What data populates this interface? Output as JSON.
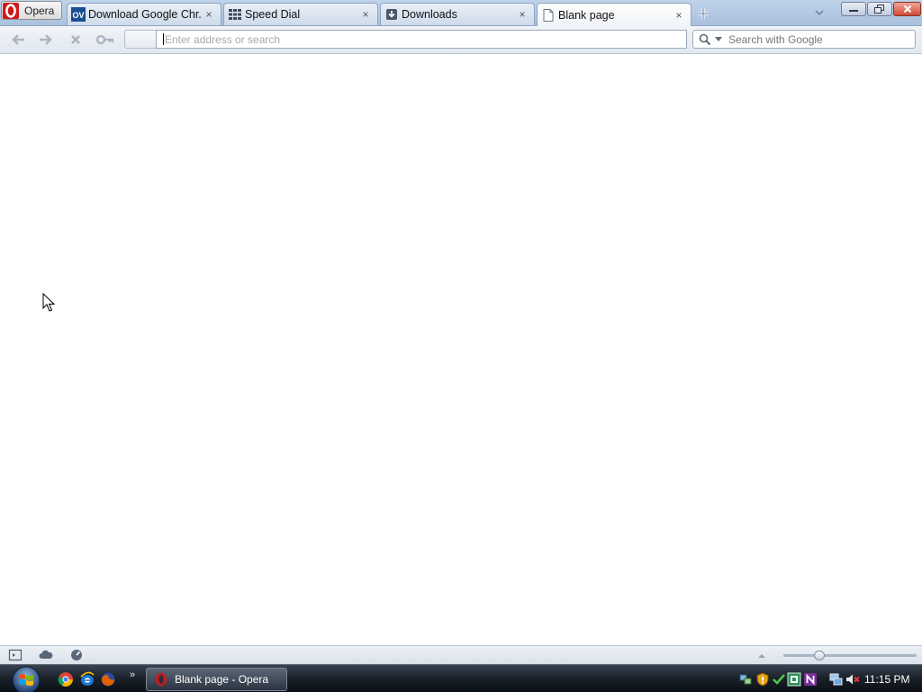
{
  "browser": {
    "menu_label": "Opera",
    "tabs": [
      {
        "label": "Download Google Chr...",
        "icon": "ov-favicon",
        "active": false
      },
      {
        "label": "Speed Dial",
        "icon": "speed-dial-grid-icon",
        "active": false
      },
      {
        "label": "Downloads",
        "icon": "downloads-icon",
        "active": false
      },
      {
        "label": "Blank page",
        "icon": "blank-page-icon",
        "active": true
      }
    ],
    "tab_close_glyph": "×"
  },
  "navbar": {
    "address_placeholder": "Enter address or search",
    "address_value": "",
    "search_placeholder": "Search with Google"
  },
  "taskbar": {
    "running_window_label": "Blank page - Opera",
    "more_glyph": "»",
    "clock": "11:15 PM"
  },
  "colors": {
    "chrome_bg": "#bfd3ea",
    "taskbar_bg": "#1c232c",
    "opera_red": "#cc1a1a"
  }
}
